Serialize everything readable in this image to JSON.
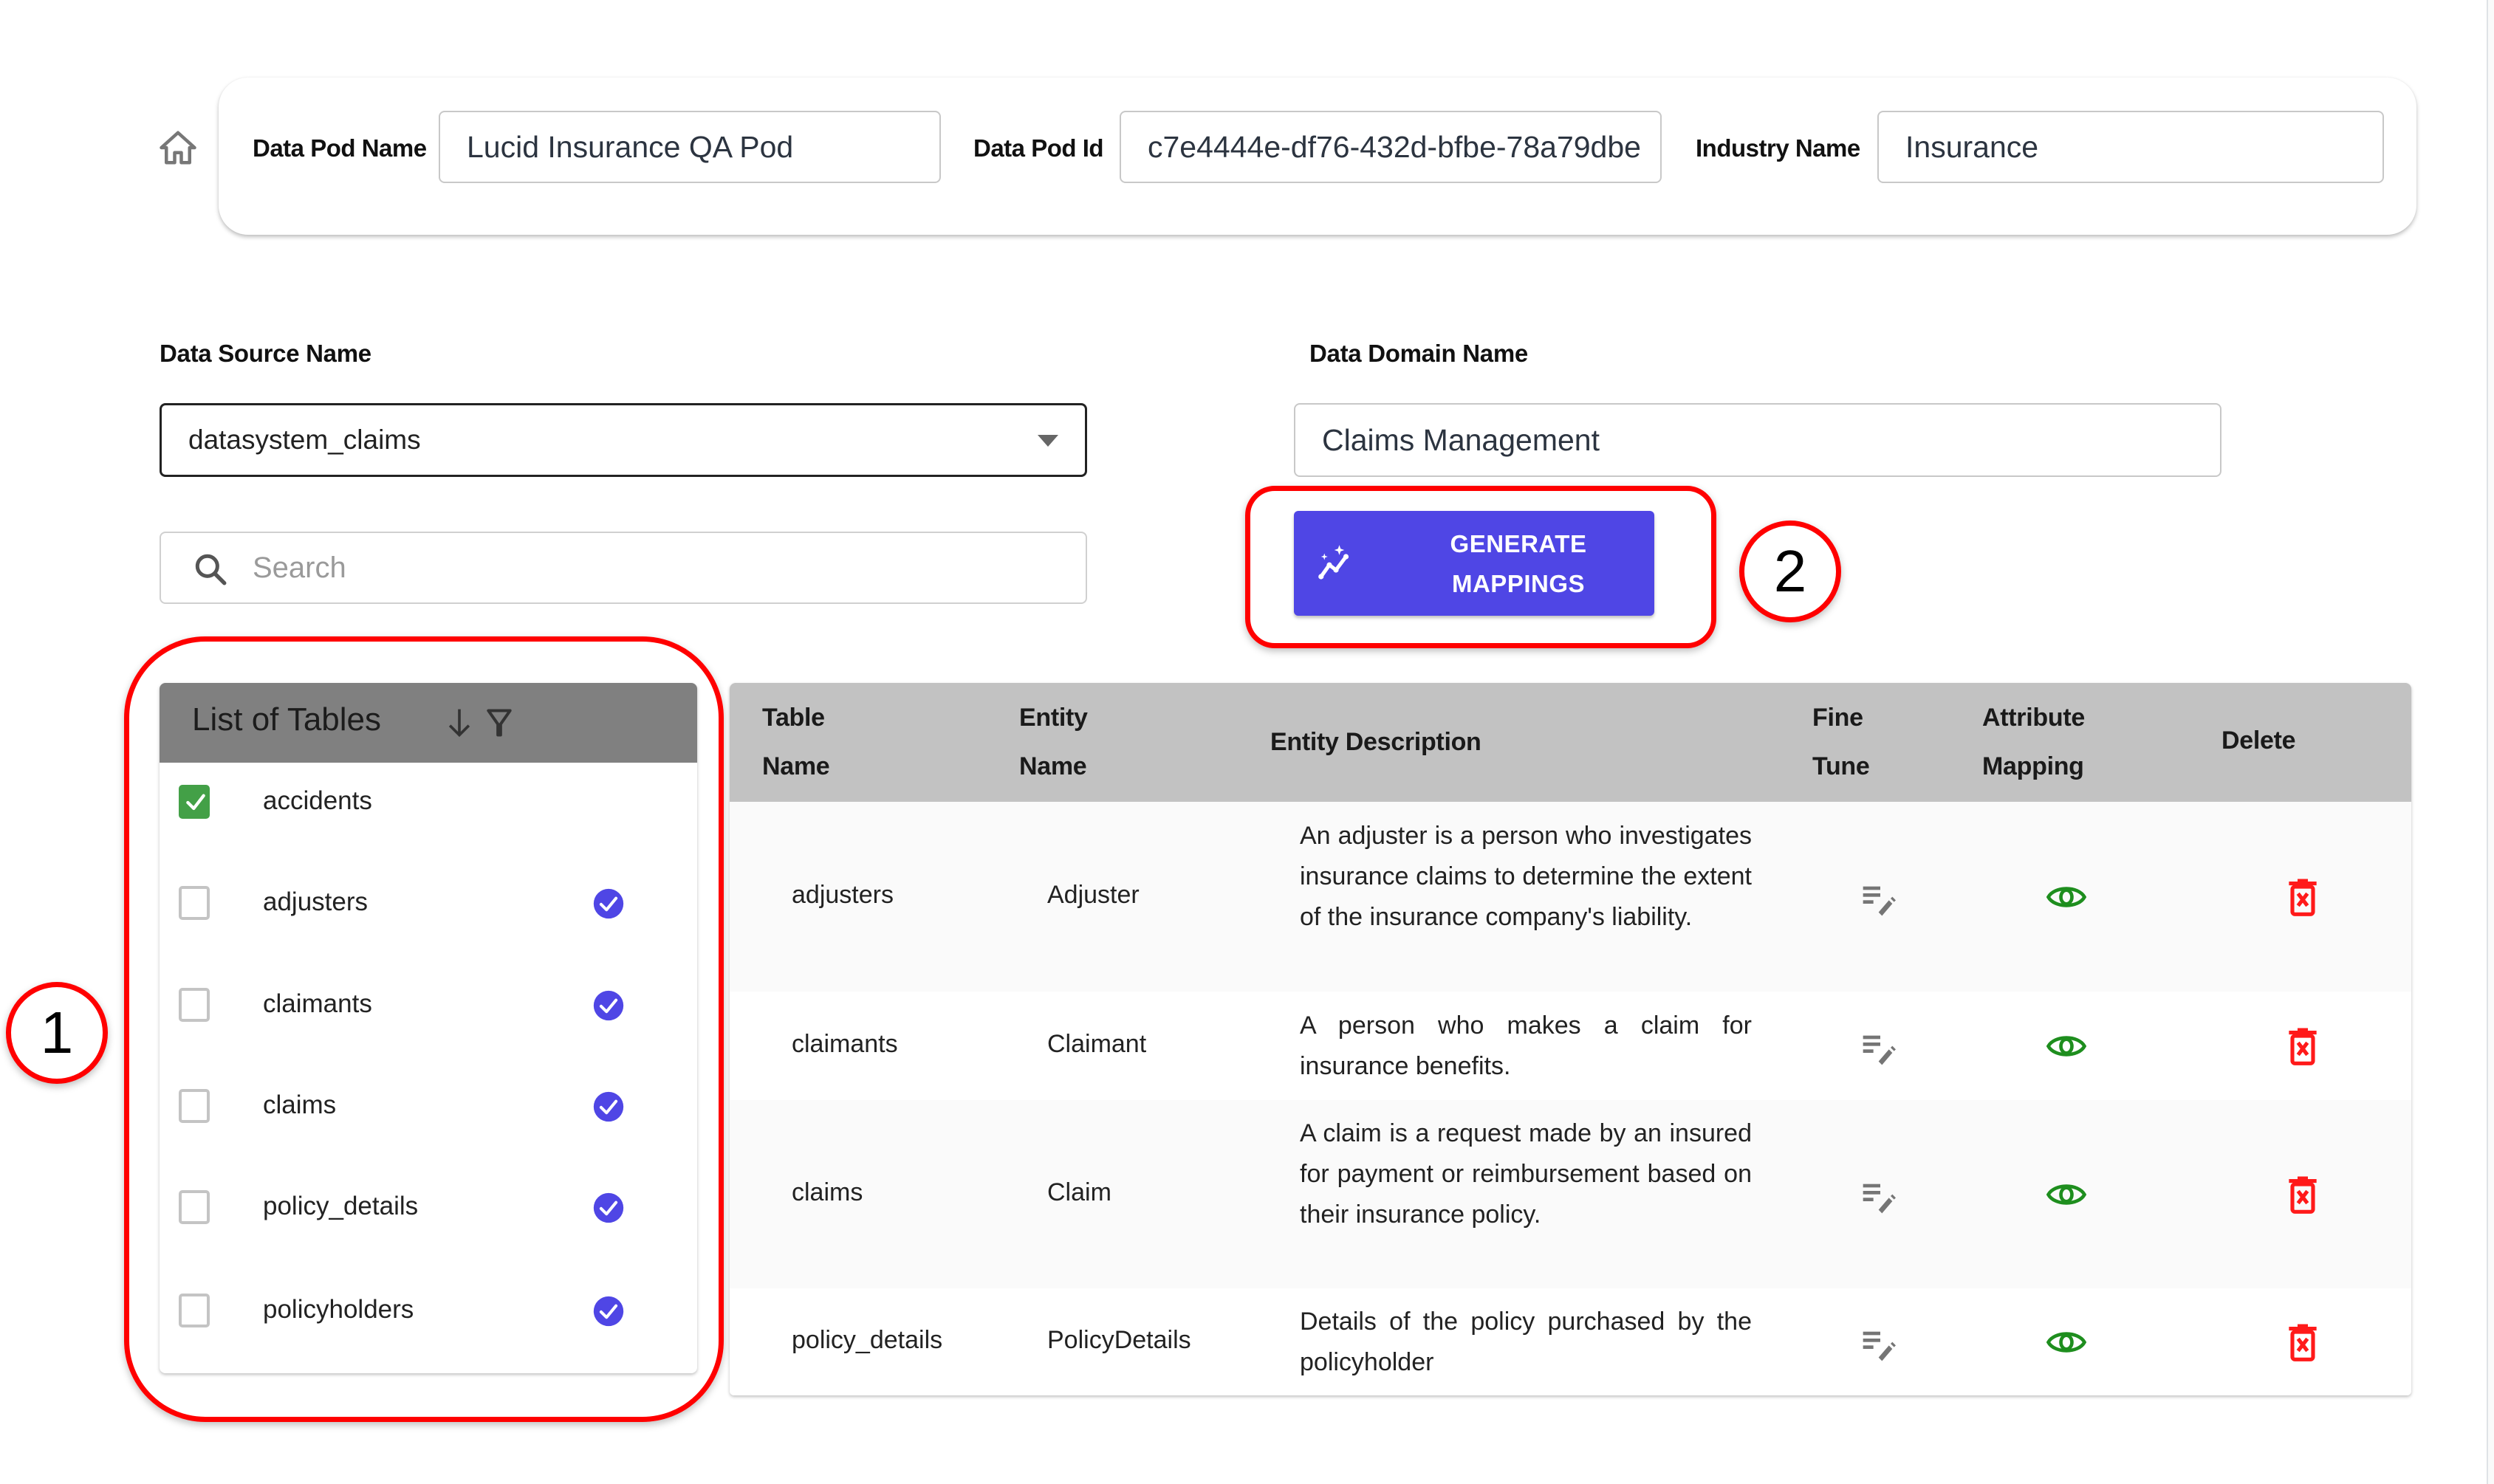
{
  "header": {
    "pod_name_label": "Data Pod Name",
    "pod_name_value": "Lucid Insurance QA Pod",
    "pod_id_label": "Data Pod Id",
    "pod_id_value": "c7e4444e-df76-432d-bfbe-78a79dbe",
    "industry_label": "Industry Name",
    "industry_value": "Insurance"
  },
  "data_source": {
    "label": "Data Source Name",
    "selected": "datasystem_claims"
  },
  "search": {
    "placeholder": "Search"
  },
  "data_domain": {
    "label": "Data Domain Name",
    "value": "Claims Management"
  },
  "generate_button": {
    "line1": "GENERATE",
    "line2": "MAPPINGS",
    "color": "#4f46e5"
  },
  "annotations": {
    "marker1": "1",
    "marker2": "2",
    "color": "#ff0000"
  },
  "table_list": {
    "title": "List of Tables",
    "items": [
      {
        "name": "accidents",
        "checked": true,
        "mapped": false
      },
      {
        "name": "adjusters",
        "checked": false,
        "mapped": true
      },
      {
        "name": "claimants",
        "checked": false,
        "mapped": true
      },
      {
        "name": "claims",
        "checked": false,
        "mapped": true
      },
      {
        "name": "policy_details",
        "checked": false,
        "mapped": true
      },
      {
        "name": "policyholders",
        "checked": false,
        "mapped": true
      }
    ]
  },
  "mapping_table": {
    "columns": {
      "table_name": [
        "Table",
        "Name"
      ],
      "entity_name": [
        "Entity",
        "Name"
      ],
      "entity_description": "Entity Description",
      "fine_tune": [
        "Fine",
        "Tune"
      ],
      "attribute_mapping": [
        "Attribute",
        "Mapping"
      ],
      "delete": "Delete"
    },
    "rows": [
      {
        "table": "adjusters",
        "entity": "Adjuster",
        "description": "An adjuster is a person who investigates insurance claims to determine the extent of the insurance company's liability."
      },
      {
        "table": "claimants",
        "entity": "Claimant",
        "description": "A person who makes a claim for insurance benefits."
      },
      {
        "table": "claims",
        "entity": "Claim",
        "description": "A claim is a request made by an insured for payment or reimbursement based on their insurance policy."
      },
      {
        "table": "policy_details",
        "entity": "PolicyDetails",
        "description": "Details of the policy purchased by the policyholder"
      }
    ],
    "icon_colors": {
      "fine_tune": "#757575",
      "view": "#1e8e1e",
      "delete": "#ff1a1a"
    }
  }
}
